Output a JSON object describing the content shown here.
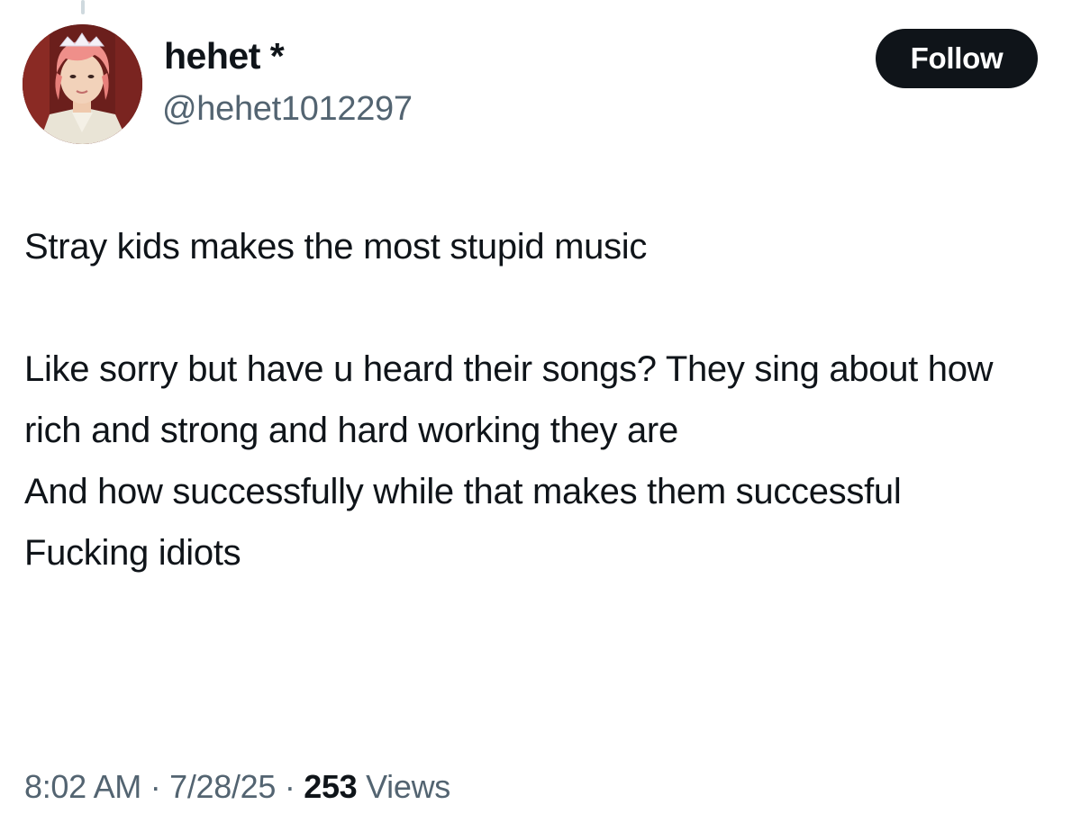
{
  "author": {
    "display_name": "hehet *",
    "handle": "@hehet1012297"
  },
  "follow_button": {
    "label": "Follow"
  },
  "tweet": {
    "lines": [
      "Stray kids makes the most stupid music",
      "",
      "Like sorry but have u heard their songs? They sing about how rich and strong and hard working they are",
      "And how successfully while that makes them successful",
      "Fucking idiots"
    ]
  },
  "meta": {
    "time": "8:02 AM",
    "separator": "·",
    "date": "7/28/25",
    "views_count": "253",
    "views_label": "Views"
  },
  "colors": {
    "text": "#0f1419",
    "secondary": "#536471",
    "button_bg": "#0f1419",
    "button_text": "#ffffff"
  }
}
